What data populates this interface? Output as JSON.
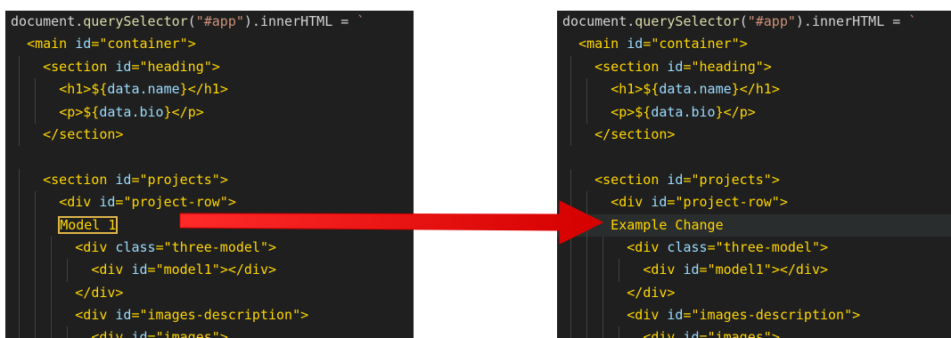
{
  "left_panel": {
    "lines": [
      [
        {
          "t": "document",
          "c": "plain"
        },
        {
          "t": ".",
          "c": "plain"
        },
        {
          "t": "querySelector",
          "c": "method"
        },
        {
          "t": "(",
          "c": "plain"
        },
        {
          "t": "\"#app\"",
          "c": "str"
        },
        {
          "t": ").innerHTML",
          "c": "plain"
        },
        {
          "t": " = ",
          "c": "plain"
        },
        {
          "t": "`",
          "c": "str"
        }
      ],
      [
        {
          "t": "  <main id=\"container\">",
          "c": "text"
        }
      ],
      [
        {
          "t": "    <section id=\"heading\">",
          "c": "text"
        }
      ],
      [
        {
          "t": "      <h1>${data.name}</h1>",
          "c": "text"
        }
      ],
      [
        {
          "t": "      <p>${data.bio}</p>",
          "c": "text"
        }
      ],
      [
        {
          "t": "    </section>",
          "c": "text"
        }
      ],
      [
        {
          "t": "",
          "c": "plain"
        }
      ],
      [
        {
          "t": "    <section id=\"projects\">",
          "c": "text"
        }
      ],
      [
        {
          "t": "      <div id=\"project-row\">",
          "c": "text"
        }
      ],
      [
        {
          "t": "      ",
          "c": "plain"
        },
        {
          "t": "Model 1",
          "c": "text",
          "sel": true
        }
      ],
      [
        {
          "t": "        <div class=\"three-model\">",
          "c": "text"
        }
      ],
      [
        {
          "t": "          <div id=\"model1\"></div>",
          "c": "text"
        }
      ],
      [
        {
          "t": "        </div>",
          "c": "text"
        }
      ],
      [
        {
          "t": "        <div id=\"images-description\">",
          "c": "text"
        }
      ],
      [
        {
          "t": "          <div id=\"images\">",
          "c": "text"
        }
      ]
    ]
  },
  "right_panel": {
    "lines": [
      [
        {
          "t": "document",
          "c": "plain"
        },
        {
          "t": ".",
          "c": "plain"
        },
        {
          "t": "querySelector",
          "c": "method"
        },
        {
          "t": "(",
          "c": "plain"
        },
        {
          "t": "\"#app\"",
          "c": "str"
        },
        {
          "t": ").innerHTML",
          "c": "plain"
        },
        {
          "t": " = ",
          "c": "plain"
        },
        {
          "t": "`",
          "c": "str"
        }
      ],
      [
        {
          "t": "  <main id=\"container\">",
          "c": "text"
        }
      ],
      [
        {
          "t": "    <section id=\"heading\">",
          "c": "text"
        }
      ],
      [
        {
          "t": "      <h1>${data.name}</h1>",
          "c": "text"
        }
      ],
      [
        {
          "t": "      <p>${data.bio}</p>",
          "c": "text"
        }
      ],
      [
        {
          "t": "    </section>",
          "c": "text"
        }
      ],
      [
        {
          "t": "",
          "c": "plain"
        }
      ],
      [
        {
          "t": "    <section id=\"projects\">",
          "c": "text"
        }
      ],
      [
        {
          "t": "      <div id=\"project-row\">",
          "c": "text"
        }
      ],
      [
        {
          "t": "      Example Change",
          "c": "text"
        }
      ],
      [
        {
          "t": "        <div class=\"three-model\">",
          "c": "text"
        }
      ],
      [
        {
          "t": "          <div id=\"model1\"></div>",
          "c": "text"
        }
      ],
      [
        {
          "t": "        </div>",
          "c": "text"
        }
      ],
      [
        {
          "t": "        <div id=\"images-description\">",
          "c": "text"
        }
      ],
      [
        {
          "t": "          <div id=\"images\">",
          "c": "text"
        }
      ]
    ],
    "current_line": 9
  },
  "arrow": {
    "color": "#e00000"
  }
}
